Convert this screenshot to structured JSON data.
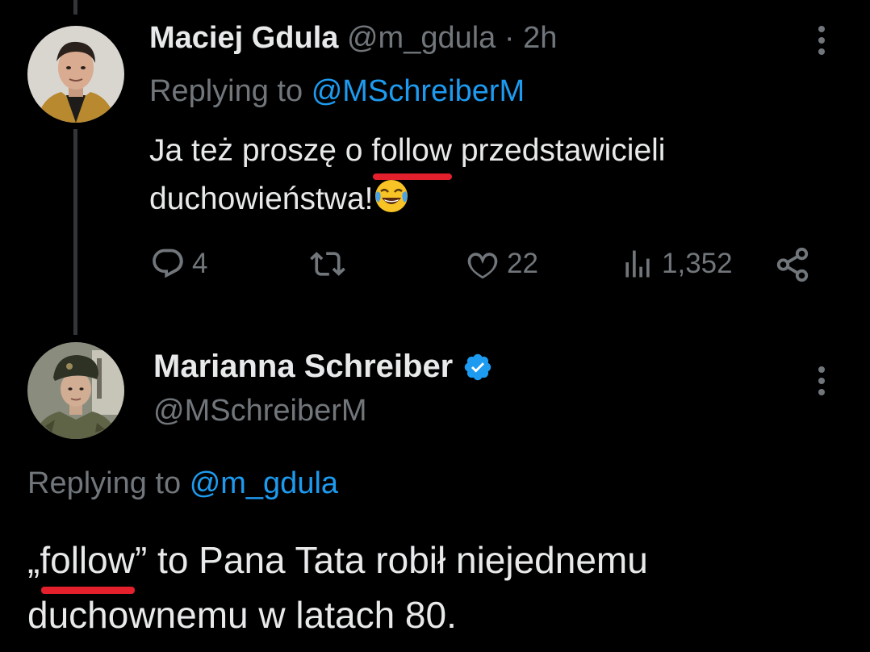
{
  "tweet1": {
    "name": "Maciej Gdula",
    "handle": "@m_gdula",
    "separator": "·",
    "time": "2h",
    "replying_prefix": "Replying to",
    "replying_mention": "@MSchreiberM",
    "body_before": "Ja też proszę o ",
    "body_highlight": "follow",
    "body_after": " przedstawicieli duchowieństwa!",
    "emoji": "face-with-tears-of-joy",
    "reply_count": "4",
    "retweet_count": "",
    "like_count": "22",
    "views_count": "1,352"
  },
  "tweet2": {
    "name": "Marianna Schreiber",
    "handle": "@MSchreiberM",
    "verified": true,
    "replying_prefix": "Replying to",
    "replying_mention": "@m_gdula",
    "body_open_quote": "„",
    "body_highlight": "follow",
    "body_after": "” to Pana Tata robił niejednemu duchownemu w latach 80."
  },
  "colors": {
    "background": "#000000",
    "text": "#e7e9ea",
    "muted": "#71767b",
    "accent": "#1d9bf0",
    "annotation": "#e3202b"
  },
  "icons": [
    "reply-icon",
    "retweet-icon",
    "like-icon",
    "views-icon",
    "share-icon",
    "more-icon",
    "verified-badge-icon"
  ]
}
